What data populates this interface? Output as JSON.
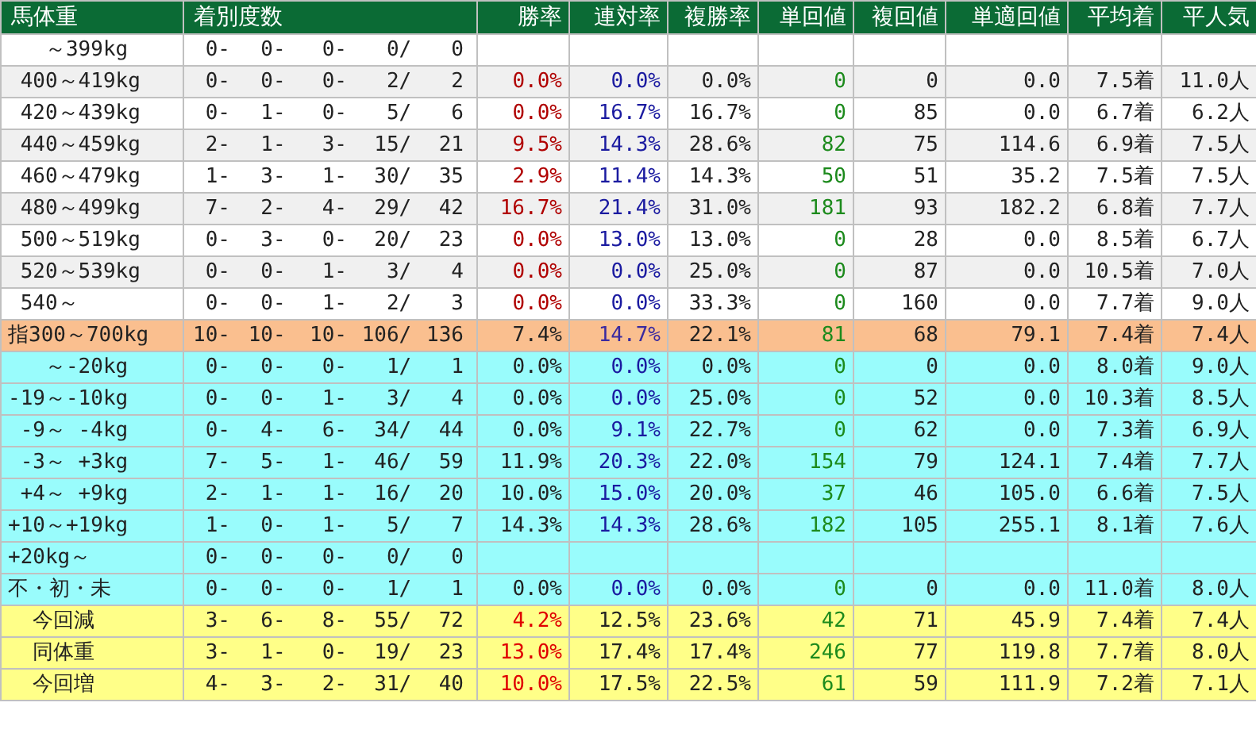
{
  "table": {
    "columns": [
      "馬体重",
      "着別度数",
      "勝率",
      "連対率",
      "複勝率",
      "単回値",
      "複回値",
      "単適回値",
      "平均着",
      "平人気"
    ],
    "rows": [
      {
        "kind": "weight",
        "label": "   ～399kg",
        "record": [
          "0-",
          "0-",
          "0-",
          "0/",
          "0"
        ]
      },
      {
        "kind": "weight",
        "label": " 400～419kg",
        "record": [
          "0-",
          "0-",
          "0-",
          "2/",
          "2"
        ],
        "rates": [
          "0.0%",
          "0.0%",
          "0.0%",
          "0",
          "0",
          "0.0",
          "7.5着",
          "11.0人"
        ]
      },
      {
        "kind": "weight",
        "label": " 420～439kg",
        "record": [
          "0-",
          "1-",
          "0-",
          "5/",
          "6"
        ],
        "rates": [
          "0.0%",
          "16.7%",
          "16.7%",
          "0",
          "85",
          "0.0",
          "6.7着",
          "6.2人"
        ]
      },
      {
        "kind": "weight",
        "label": " 440～459kg",
        "record": [
          "2-",
          "1-",
          "3-",
          "15/",
          "21"
        ],
        "rates": [
          "9.5%",
          "14.3%",
          "28.6%",
          "82",
          "75",
          "114.6",
          "6.9着",
          "7.5人"
        ]
      },
      {
        "kind": "weight",
        "label": " 460～479kg",
        "record": [
          "1-",
          "3-",
          "1-",
          "30/",
          "35"
        ],
        "rates": [
          "2.9%",
          "11.4%",
          "14.3%",
          "50",
          "51",
          "35.2",
          "7.5着",
          "7.5人"
        ]
      },
      {
        "kind": "weight",
        "label": " 480～499kg",
        "record": [
          "7-",
          "2-",
          "4-",
          "29/",
          "42"
        ],
        "rates": [
          "16.7%",
          "21.4%",
          "31.0%",
          "181",
          "93",
          "182.2",
          "6.8着",
          "7.7人"
        ]
      },
      {
        "kind": "weight",
        "label": " 500～519kg",
        "record": [
          "0-",
          "3-",
          "0-",
          "20/",
          "23"
        ],
        "rates": [
          "0.0%",
          "13.0%",
          "13.0%",
          "0",
          "28",
          "0.0",
          "8.5着",
          "6.7人"
        ]
      },
      {
        "kind": "weight",
        "label": " 520～539kg",
        "record": [
          "0-",
          "0-",
          "1-",
          "3/",
          "4"
        ],
        "rates": [
          "0.0%",
          "0.0%",
          "25.0%",
          "0",
          "87",
          "0.0",
          "10.5着",
          "7.0人"
        ]
      },
      {
        "kind": "weight",
        "label": " 540～",
        "record": [
          "0-",
          "0-",
          "1-",
          "2/",
          "3"
        ],
        "rates": [
          "0.0%",
          "0.0%",
          "33.3%",
          "0",
          "160",
          "0.0",
          "7.7着",
          "9.0人"
        ]
      },
      {
        "kind": "total",
        "label": "指300～700kg",
        "record": [
          "10-",
          "10-",
          "10-",
          "106/",
          "136"
        ],
        "rates": [
          "7.4%",
          "14.7%",
          "22.1%",
          "81",
          "68",
          "79.1",
          "7.4着",
          "7.4人"
        ]
      },
      {
        "kind": "change",
        "label": "   ～-20kg",
        "record": [
          "0-",
          "0-",
          "0-",
          "1/",
          "1"
        ],
        "rates": [
          "0.0%",
          "0.0%",
          "0.0%",
          "0",
          "0",
          "0.0",
          "8.0着",
          "9.0人"
        ]
      },
      {
        "kind": "change",
        "label": "-19～-10kg",
        "record": [
          "0-",
          "0-",
          "1-",
          "3/",
          "4"
        ],
        "rates": [
          "0.0%",
          "0.0%",
          "25.0%",
          "0",
          "52",
          "0.0",
          "10.3着",
          "8.5人"
        ]
      },
      {
        "kind": "change",
        "label": " -9～ -4kg",
        "record": [
          "0-",
          "4-",
          "6-",
          "34/",
          "44"
        ],
        "rates": [
          "0.0%",
          "9.1%",
          "22.7%",
          "0",
          "62",
          "0.0",
          "7.3着",
          "6.9人"
        ]
      },
      {
        "kind": "change",
        "label": " -3～ +3kg",
        "record": [
          "7-",
          "5-",
          "1-",
          "46/",
          "59"
        ],
        "rates": [
          "11.9%",
          "20.3%",
          "22.0%",
          "154",
          "79",
          "124.1",
          "7.4着",
          "7.7人"
        ]
      },
      {
        "kind": "change",
        "label": " +4～ +9kg",
        "record": [
          "2-",
          "1-",
          "1-",
          "16/",
          "20"
        ],
        "rates": [
          "10.0%",
          "15.0%",
          "20.0%",
          "37",
          "46",
          "105.0",
          "6.6着",
          "7.5人"
        ]
      },
      {
        "kind": "change",
        "label": "+10～+19kg",
        "record": [
          "1-",
          "0-",
          "1-",
          "5/",
          "7"
        ],
        "rates": [
          "14.3%",
          "14.3%",
          "28.6%",
          "182",
          "105",
          "255.1",
          "8.1着",
          "7.6人"
        ]
      },
      {
        "kind": "change",
        "label": "+20kg～",
        "record": [
          "0-",
          "0-",
          "0-",
          "0/",
          "0"
        ]
      },
      {
        "kind": "change",
        "label": "不・初・未",
        "record": [
          "0-",
          "0-",
          "0-",
          "1/",
          "1"
        ],
        "rates": [
          "0.0%",
          "0.0%",
          "0.0%",
          "0",
          "0",
          "0.0",
          "11.0着",
          "8.0人"
        ]
      },
      {
        "kind": "summary",
        "label": "  今回減",
        "record": [
          "3-",
          "6-",
          "8-",
          "55/",
          "72"
        ],
        "rates": [
          "4.2%",
          "12.5%",
          "23.6%",
          "42",
          "71",
          "45.9",
          "7.4着",
          "7.4人"
        ]
      },
      {
        "kind": "summary",
        "label": "  同体重",
        "record": [
          "3-",
          "1-",
          "0-",
          "19/",
          "23"
        ],
        "rates": [
          "13.0%",
          "17.4%",
          "17.4%",
          "246",
          "77",
          "119.8",
          "7.7着",
          "8.0人"
        ]
      },
      {
        "kind": "summary",
        "label": "  今回増",
        "record": [
          "4-",
          "3-",
          "2-",
          "31/",
          "40"
        ],
        "rates": [
          "10.0%",
          "17.5%",
          "22.5%",
          "61",
          "59",
          "111.9",
          "7.2着",
          "7.1人"
        ]
      }
    ]
  }
}
